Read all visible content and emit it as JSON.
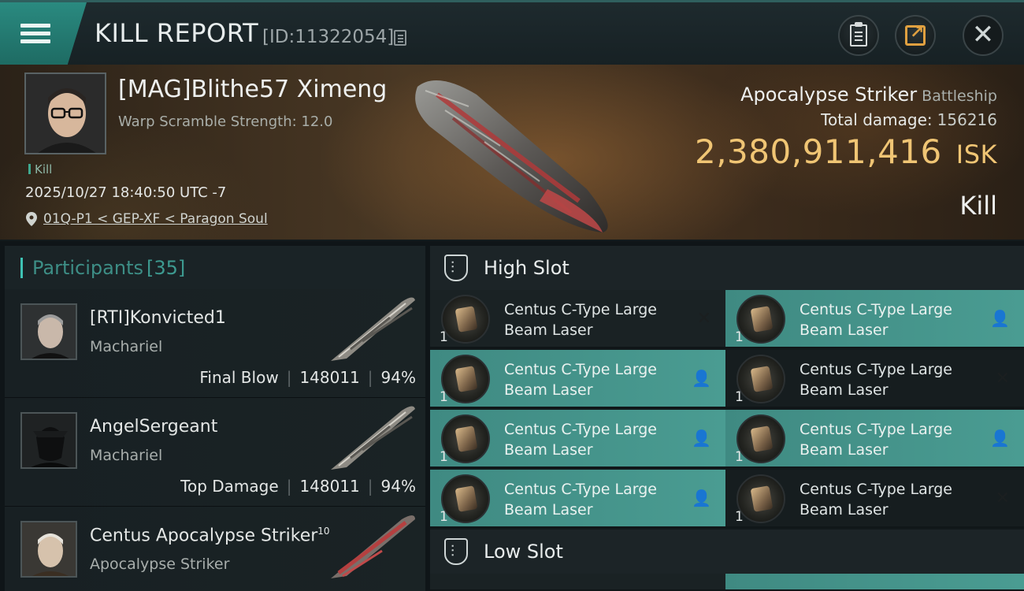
{
  "header": {
    "title": "KILL REPORT",
    "report_id": "[ID:11322054]"
  },
  "victim": {
    "name": "[MAG]Blithe57 Ximeng",
    "warp_scramble": "Warp Scramble Strength: 12.0",
    "kill_tag": "Kill",
    "timestamp": "2025/10/27 18:40:50 UTC -7",
    "location": "01Q-P1 < GEP-XF < Paragon Soul",
    "ship_name": "Apocalypse Striker",
    "ship_class": "Battleship",
    "total_damage_label": "Total damage:",
    "total_damage": "156216",
    "isk_value": "2,380,911,416",
    "isk_unit": "ISK",
    "result": "Kill"
  },
  "participants": {
    "label": "Participants",
    "count": "[35]",
    "rows": [
      {
        "name": "[RTI]Konvicted1",
        "ship": "Machariel",
        "role": "Final Blow",
        "damage": "148011",
        "percent": "94%"
      },
      {
        "name": "AngelSergeant",
        "ship": "Machariel",
        "role": "Top Damage",
        "damage": "148011",
        "percent": "94%"
      },
      {
        "name": "Centus Apocalypse Striker",
        "sup": "10",
        "ship": "Apocalypse Striker"
      }
    ]
  },
  "fitting": {
    "high_slot_label": "High Slot",
    "low_slot_label": "Low Slot",
    "modules": [
      {
        "name": "Centus C-Type Large Beam Laser",
        "qty": "1",
        "state": "✕"
      },
      {
        "name": "Centus C-Type Large Beam Laser",
        "qty": "1",
        "state": "👤"
      },
      {
        "name": "Centus C-Type Large Beam Laser",
        "qty": "1",
        "state": "👤"
      },
      {
        "name": "Centus C-Type Large Beam Laser",
        "qty": "1",
        "state": "✕"
      },
      {
        "name": "Centus C-Type Large Beam Laser",
        "qty": "1",
        "state": "👤"
      },
      {
        "name": "Centus C-Type Large Beam Laser",
        "qty": "1",
        "state": "👤"
      },
      {
        "name": "Centus C-Type Large Beam Laser",
        "qty": "1",
        "state": "👤"
      },
      {
        "name": "Centus C-Type Large Beam Laser",
        "qty": "1",
        "state": "✕"
      }
    ]
  },
  "icons": {
    "menu": "hamburger-icon",
    "copy": "copy-icon",
    "clipboard": "clipboard-icon",
    "share": "share-icon",
    "close": "close-icon",
    "location": "location-pin-icon",
    "dropped": "person-icon",
    "destroyed": "x-mark-icon"
  },
  "colors": {
    "accent_teal": "#3f8a82",
    "isk_gold": "#f0c574",
    "share_orange": "#e0a040"
  }
}
